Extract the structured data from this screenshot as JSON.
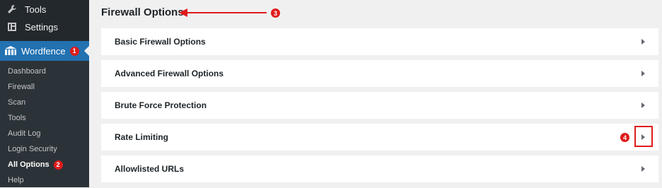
{
  "sidebar": {
    "top_items": [
      {
        "label": "Tools",
        "icon": "wrench-icon"
      },
      {
        "label": "Settings",
        "icon": "settings-icon"
      }
    ],
    "wordfence": {
      "label": "Wordfence",
      "icon": "wordfence-icon",
      "badge": "1"
    },
    "submenu": [
      {
        "label": "Dashboard"
      },
      {
        "label": "Firewall"
      },
      {
        "label": "Scan"
      },
      {
        "label": "Tools"
      },
      {
        "label": "Audit Log"
      },
      {
        "label": "Login Security"
      },
      {
        "label": "All Options",
        "active": true,
        "badge": "2"
      },
      {
        "label": "Help"
      }
    ]
  },
  "main": {
    "title": "Firewall Options",
    "title_badge": "3",
    "panels": [
      {
        "label": "Basic Firewall Options"
      },
      {
        "label": "Advanced Firewall Options"
      },
      {
        "label": "Brute Force Protection"
      },
      {
        "label": "Rate Limiting",
        "badge": "4"
      },
      {
        "label": "Allowlisted URLs"
      }
    ]
  },
  "colors": {
    "annotation_red": "#e01b1b",
    "wp_blue": "#2271b1",
    "sidebar_dark": "#23282d"
  }
}
